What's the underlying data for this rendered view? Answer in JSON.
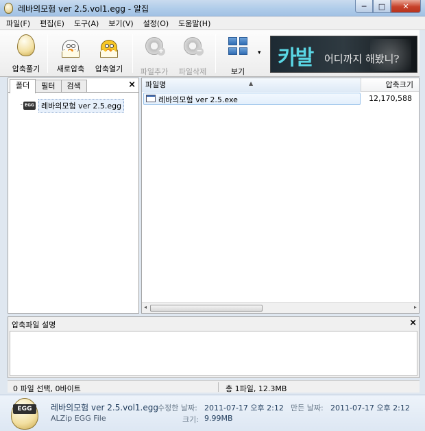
{
  "window": {
    "title": "레바의모험 ver 2.5.vol1.egg - 알집",
    "minimize": "─",
    "maximize": "□",
    "close": "✕"
  },
  "menu": [
    "파일(F)",
    "편집(E)",
    "도구(A)",
    "보기(V)",
    "설정(O)",
    "도움말(H)"
  ],
  "toolbar": {
    "extract": "압축풀기",
    "new_archive": "새로압축",
    "open_archive": "압축열기",
    "add_file": "파일추가",
    "delete_file": "파일삭제",
    "view": "보기",
    "view_dropdown": "▾",
    "banner_main": "카발",
    "banner_sub": "어디까지 해봤니?"
  },
  "left_panel": {
    "tabs": [
      "폴더",
      "필터",
      "검색"
    ],
    "close": "×",
    "tree_item": "레바의모험 ver 2.5.egg",
    "badge": "EGG"
  },
  "file_list": {
    "columns": [
      "파일명",
      "압축크기"
    ],
    "rows": [
      {
        "name": "레바의모험 ver 2.5.exe",
        "size": "12,170,588"
      }
    ]
  },
  "description": {
    "title": "압축파일 설명",
    "close": "×"
  },
  "status": {
    "left": "0 파일 선택,  0바이트",
    "right": "총 1파일,  12.3MB"
  },
  "details": {
    "badge": "EGG",
    "filename": "레바의모험 ver 2.5.vol1.egg",
    "type": "ALZip EGG File",
    "modified_label": "수정한 날짜:",
    "modified_value": "2011-07-17 오후 2:12",
    "created_label": "만든 날짜:",
    "created_value": "2011-07-17 오후 2:12",
    "size_label": "크기:",
    "size_value": "9.99MB"
  }
}
